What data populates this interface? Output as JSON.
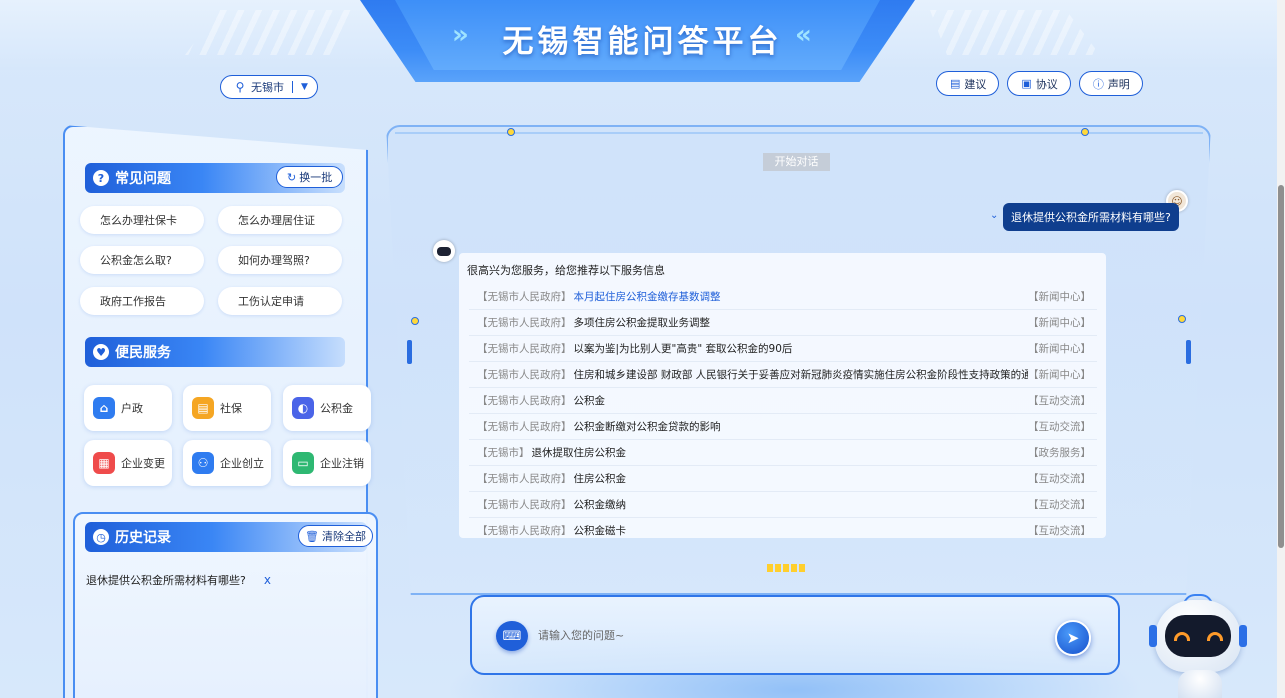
{
  "header": {
    "title": "无锡智能问答平台",
    "city": "无锡市",
    "buttons": [
      {
        "label": "建议",
        "icon": "suggestion-icon"
      },
      {
        "label": "协议",
        "icon": "agreement-icon"
      },
      {
        "label": "声明",
        "icon": "statement-icon"
      }
    ]
  },
  "faq": {
    "title": "常见问题",
    "refresh_label": "换一批",
    "items": [
      "怎么办理社保卡",
      "怎么办理居住证",
      "公积金怎么取?",
      "如何办理驾照?",
      "政府工作报告",
      "工伤认定申请"
    ]
  },
  "services": {
    "title": "便民服务",
    "items": [
      {
        "label": "户政",
        "icon": "household-icon",
        "color": "#2f7cf0"
      },
      {
        "label": "社保",
        "icon": "social-security-icon",
        "color": "#f5a623"
      },
      {
        "label": "公积金",
        "icon": "housing-fund-icon",
        "color": "#4a64e8"
      },
      {
        "label": "企业变更",
        "icon": "enterprise-change-icon",
        "color": "#ef4b4b"
      },
      {
        "label": "企业创立",
        "icon": "enterprise-create-icon",
        "color": "#2f7cf0"
      },
      {
        "label": "企业注销",
        "icon": "enterprise-cancel-icon",
        "color": "#2eb872"
      }
    ]
  },
  "history": {
    "title": "历史记录",
    "clear_label": "清除全部",
    "items": [
      {
        "text": "退休提供公积金所需材料有哪些?",
        "remove": "x"
      }
    ]
  },
  "chat": {
    "start_label": "开始对话",
    "user_question": "退休提供公积金所需材料有哪些?",
    "intro": "很高兴为您服务，给您推荐以下服务信息",
    "results": [
      {
        "source": "【无锡市人民政府】",
        "title": "本月起住房公积金缴存基数调整",
        "category": "【新闻中心】",
        "highlight": true
      },
      {
        "source": "【无锡市人民政府】",
        "title": "多项住房公积金提取业务调整",
        "category": "【新闻中心】",
        "highlight": false
      },
      {
        "source": "【无锡市人民政府】",
        "title": "以案为鉴|为比别人更\"高贵\" 套取公积金的90后",
        "category": "【新闻中心】",
        "highlight": false
      },
      {
        "source": "【无锡市人民政府】",
        "title": "住房和城乡建设部 财政部 人民银行关于妥善应对新冠肺炎疫情实施住房公积金阶段性支持政策的通知",
        "category": "【新闻中心】",
        "highlight": false
      },
      {
        "source": "【无锡市人民政府】",
        "title": "公积金",
        "category": "【互动交流】",
        "highlight": false
      },
      {
        "source": "【无锡市人民政府】",
        "title": "公积金断缴对公积金贷款的影响",
        "category": "【互动交流】",
        "highlight": false
      },
      {
        "source": "【无锡市】",
        "title": "退休提取住房公积金",
        "category": "【政务服务】",
        "highlight": false
      },
      {
        "source": "【无锡市人民政府】",
        "title": "住房公积金",
        "category": "【互动交流】",
        "highlight": false
      },
      {
        "source": "【无锡市人民政府】",
        "title": "公积金缴纳",
        "category": "【互动交流】",
        "highlight": false
      },
      {
        "source": "【无锡市人民政府】",
        "title": "公积金磁卡",
        "category": "【互动交流】",
        "highlight": false
      }
    ],
    "input_placeholder": "请输入您的问题~"
  },
  "colors": {
    "accent": "#1f5fd9",
    "title_plate": "#3c8cf7",
    "user_bubble": "#0f3e8e",
    "pager": "#ffcf2d"
  }
}
